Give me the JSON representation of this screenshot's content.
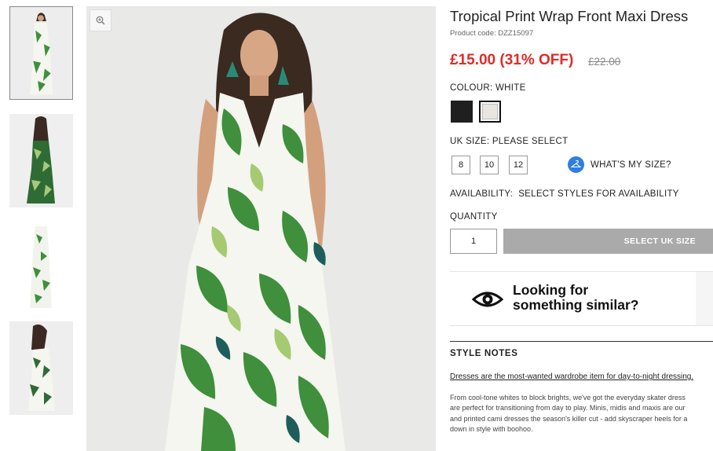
{
  "product": {
    "title": "Tropical Print Wrap Front Maxi Dress",
    "code": "Product code: DZZ15097",
    "price": "£15.00 (31% OFF)",
    "was_price": "£22.00",
    "price_color": "#e02b27"
  },
  "gallery": {
    "thumbnails": [
      "front view",
      "back view",
      "flat lay",
      "side view"
    ],
    "active_index": 0,
    "zoom_icon": "zoom-in-icon"
  },
  "colour": {
    "label": "COLOUR:",
    "value": "WHITE",
    "swatches": [
      {
        "name": "Black",
        "hex": "#1f1f1f"
      },
      {
        "name": "White",
        "hex": "#e8e6df"
      }
    ]
  },
  "size": {
    "label": "UK SIZE:",
    "value": "PLEASE SELECT",
    "options": [
      "8",
      "10",
      "12"
    ],
    "guide_label": "WHAT'S MY SIZE?",
    "guide_icon": "hanger-icon",
    "accent": "#2f7ee0"
  },
  "availability": {
    "label": "AVAILABILITY:",
    "value": "SELECT STYLES FOR AVAILABILITY"
  },
  "quantity": {
    "label": "QUANTITY",
    "value": "1"
  },
  "cta": {
    "label": "SELECT UK SIZE",
    "color": "#aaaaaa"
  },
  "similar": {
    "line1": "Looking for",
    "line2": "something similar?",
    "icon": "eye-icon"
  },
  "style_notes": {
    "heading": "STYLE NOTES",
    "link_text": "Dresses are the most-wanted wardrobe item for day-to-night dressing.",
    "body_lines": [
      "From cool-tone whites to block brights, we've got the everyday skater dress",
      "are perfect for transitioning from day to play. Minis, midis and maxis are our",
      "and printed cami dresses the season's killer cut - add skyscraper heels for a",
      "down in style with boohoo."
    ]
  }
}
